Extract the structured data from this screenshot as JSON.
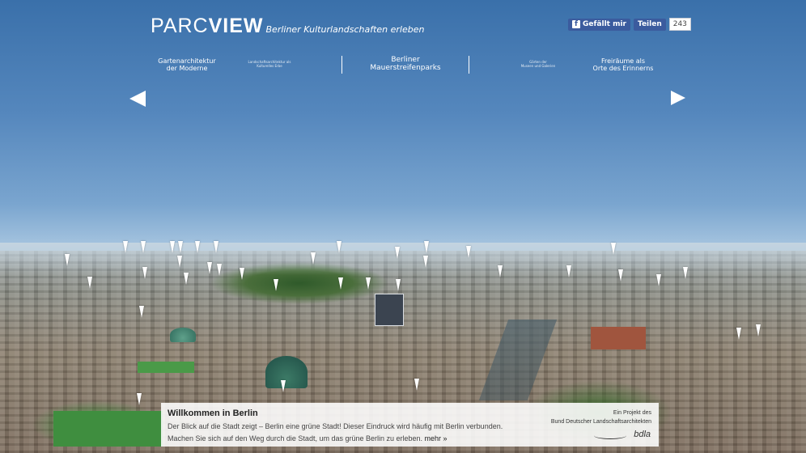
{
  "header": {
    "logo_light": "PARC",
    "logo_bold": "VIEW",
    "tagline": "Berliner Kulturlandschaften erleben"
  },
  "social": {
    "like_label": "Gefällt mir",
    "share_label": "Teilen",
    "count": "243",
    "brand_color": "#3b5b9e"
  },
  "nav": {
    "items": [
      {
        "label_line1": "Gartenarchitektur",
        "label_line2": "der Moderne"
      },
      {
        "label_line1": "Landschaftsarchitektur als",
        "label_line2": "Kulturelles Erbe"
      },
      {
        "label_line1": "Berliner",
        "label_line2": "Mauerstreifenparks"
      },
      {
        "label_line1": "Gärten der",
        "label_line2": "Museen und Galerien"
      },
      {
        "label_line1": "Freiräume als",
        "label_line2": "Orte des Erinnerns"
      }
    ],
    "active_index": 2
  },
  "icons": {
    "prev": "arrow-left-icon",
    "next": "arrow-right-icon",
    "marker": "location-pin-icon"
  },
  "info": {
    "title": "Willkommen in Berlin",
    "line1": "Der Blick auf die Stadt zeigt – Berlin eine grüne Stadt! Dieser Eindruck wird häufig mit Berlin verbunden.",
    "line2": "Machen Sie sich auf den Weg durch die Stadt, um das grüne Berlin zu erleben.",
    "more_label": "mehr »",
    "credit_line1": "Ein Projekt des",
    "credit_line2": "Bund Deutscher Landschaftsarchitekten",
    "partner_logo": "bdla"
  }
}
